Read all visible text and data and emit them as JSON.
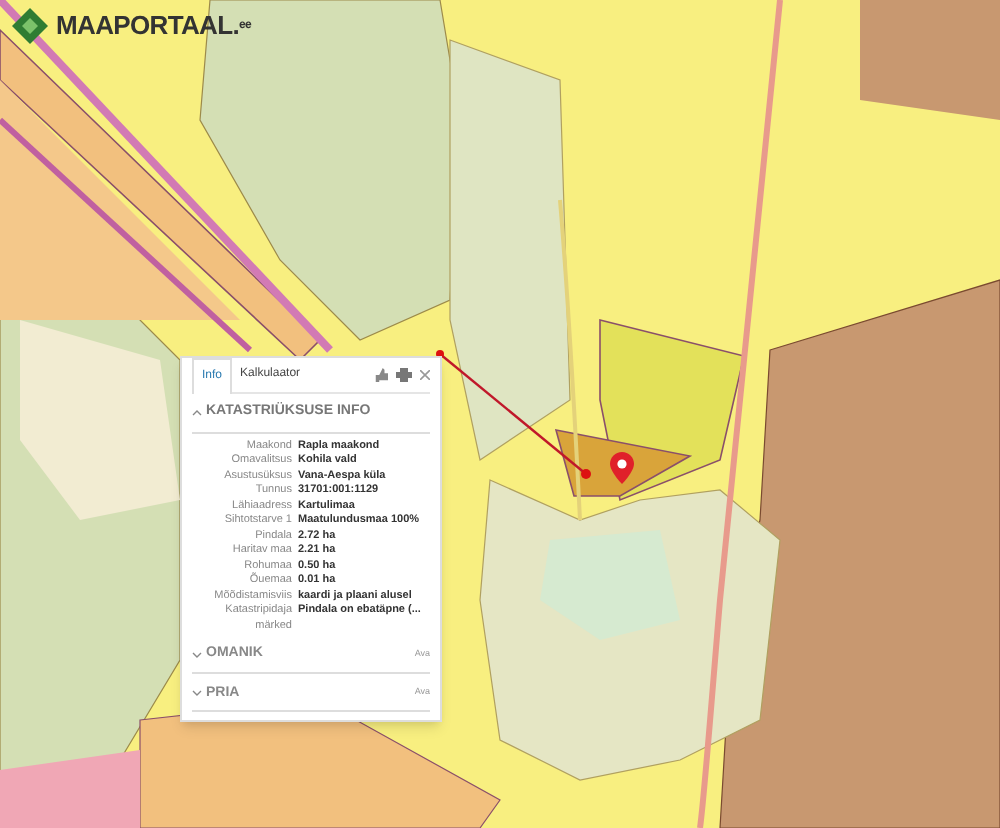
{
  "logo": {
    "text": "MAAPORTAAL.",
    "suffix": "ee"
  },
  "popup": {
    "tabs": [
      {
        "label": "Info",
        "selected": true
      },
      {
        "label": "Kalkulaator",
        "selected": false
      }
    ],
    "section": {
      "title": "KATASTRIÜKSUSE INFO",
      "expanded": true
    },
    "rows": [
      {
        "key": "Maakond",
        "value": "Rapla maakond"
      },
      {
        "key": "Omavalitsus",
        "value": "Kohila vald"
      },
      {
        "key": "Asustusüksus",
        "value": "Vana-Aespa küla"
      },
      {
        "key": "Tunnus",
        "value": "31701:001:1129"
      },
      {
        "key": "Lähiaadress",
        "value": "Kartulimaa"
      },
      {
        "key": "Sihtotstarve 1",
        "value": "Maatulundusmaa 100%"
      },
      {
        "key": "Pindala",
        "value": "2.72 ha"
      },
      {
        "key": "Haritav maa",
        "value": "2.21 ha"
      },
      {
        "key": "Rohumaa",
        "value": "0.50 ha"
      },
      {
        "key": "Õuemaa",
        "value": "0.01 ha"
      },
      {
        "key": "Mõõdistamisviis",
        "value": "kaardi ja plaani alusel"
      },
      {
        "key": "Katastripidaja märked",
        "value": "Pindala on ebatäpne (..."
      }
    ],
    "collapsed_sections": [
      {
        "title": "OMANIK",
        "action": "Ava",
        "expanded": false
      },
      {
        "title": "PRIA",
        "action": "Ava",
        "expanded": false
      }
    ]
  }
}
